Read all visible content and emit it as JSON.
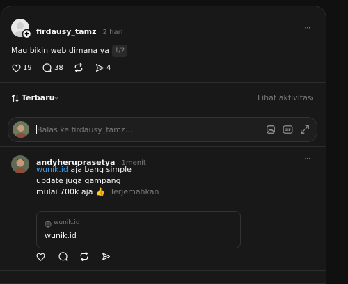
{
  "post": {
    "username": "firdausy_tamz",
    "time": "2 hari",
    "text": "Mau bikin web dimana ya",
    "page_badge": "1/2",
    "likes": "19",
    "comments": "38",
    "shares": "4",
    "more": "···"
  },
  "sort": {
    "label": "Terbaru",
    "activity_link": "Lihat aktivitas"
  },
  "reply": {
    "placeholder": "Balas ke firdausy_tamz..."
  },
  "comment": {
    "username": "andyheruprasetya",
    "time": "1menit",
    "link_text": "wunik.id",
    "line1_rest": " aja bang simple",
    "line2": "update juga gampang",
    "line3": "mulai 700k aja",
    "emoji": "👍",
    "translate": "Terjemahkan",
    "more": "···",
    "preview": {
      "domain": "wunik.id",
      "title": "wunik.id"
    }
  },
  "colors": {
    "background": "#101010",
    "card": "#181818",
    "link": "#3b97e3",
    "muted": "#777777"
  }
}
